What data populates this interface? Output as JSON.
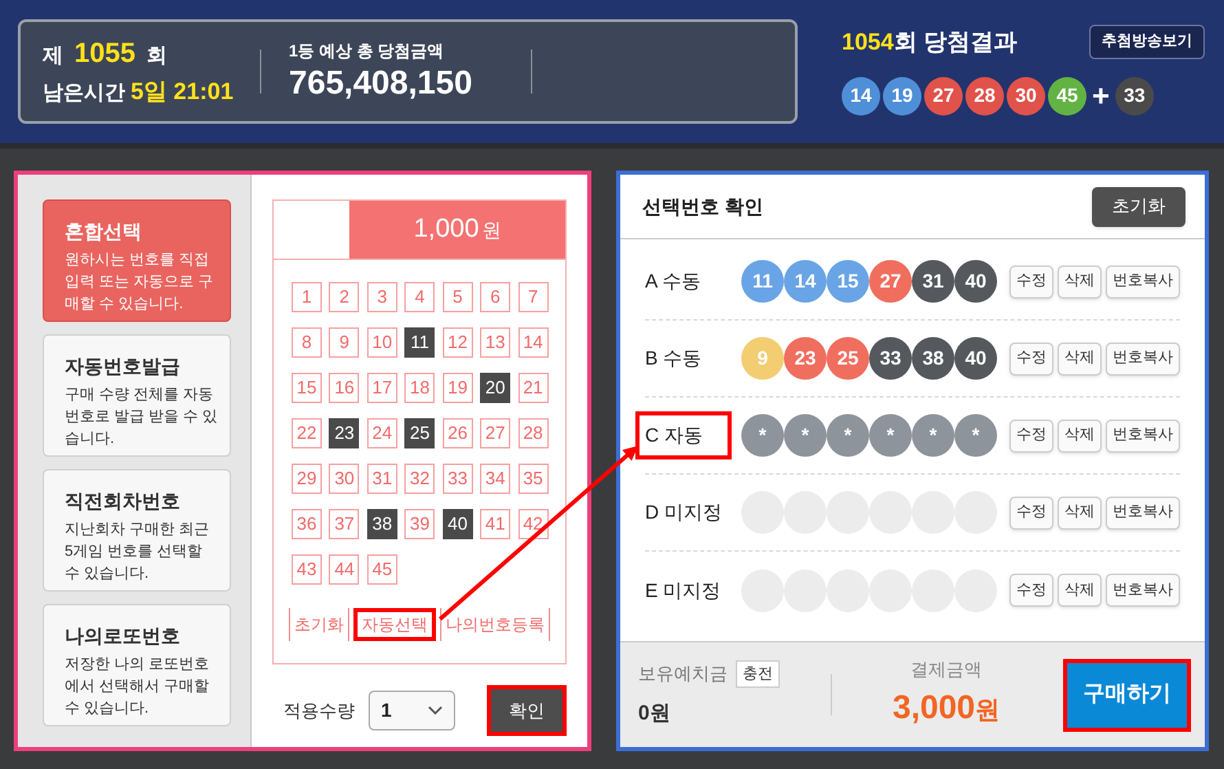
{
  "header": {
    "round_prefix": "제",
    "round_number": "1055",
    "round_suffix": "회",
    "remaining_label": "남은시간",
    "remaining_value": "5일 21:01",
    "jackpot_label": "1등 예상 총 당첨금액",
    "jackpot_amount": "765,408,150"
  },
  "last_result": {
    "round": "1054",
    "title": "회 당첨결과",
    "button": "추첨방송보기",
    "plus": "+",
    "balls": [
      {
        "number": "14",
        "color": "#4f8fd8"
      },
      {
        "number": "19",
        "color": "#4f8fd8"
      },
      {
        "number": "27",
        "color": "#e0524a"
      },
      {
        "number": "28",
        "color": "#e0524a"
      },
      {
        "number": "30",
        "color": "#e0524a"
      },
      {
        "number": "45",
        "color": "#62b344"
      }
    ],
    "bonus": {
      "number": "33",
      "color": "#4a4a4a"
    }
  },
  "modes": [
    {
      "title": "혼합선택",
      "description": "원하시는 번호를 직접 입력 또는 자동으로 구매할 수 있습니다.",
      "selected": true
    },
    {
      "title": "자동번호발급",
      "description": "구매 수량 전체를 자동번호로 발급 받을 수 있습니다.",
      "selected": false
    },
    {
      "title": "직전회차번호",
      "description": "지난회차 구매한 최근 5게임 번호를 선택할 수 있습니다.",
      "selected": false
    },
    {
      "title": "나의로또번호",
      "description": "저장한 나의 로또번호에서 선택해서 구매할 수 있습니다.",
      "selected": false
    }
  ],
  "ticket": {
    "price": "1,000",
    "price_unit": "원",
    "numbers": [
      {
        "number": "1",
        "selected": false
      },
      {
        "number": "2",
        "selected": false
      },
      {
        "number": "3",
        "selected": false
      },
      {
        "number": "4",
        "selected": false
      },
      {
        "number": "5",
        "selected": false
      },
      {
        "number": "6",
        "selected": false
      },
      {
        "number": "7",
        "selected": false
      },
      {
        "number": "8",
        "selected": false
      },
      {
        "number": "9",
        "selected": false
      },
      {
        "number": "10",
        "selected": false
      },
      {
        "number": "11",
        "selected": true
      },
      {
        "number": "12",
        "selected": false
      },
      {
        "number": "13",
        "selected": false
      },
      {
        "number": "14",
        "selected": false
      },
      {
        "number": "15",
        "selected": false
      },
      {
        "number": "16",
        "selected": false
      },
      {
        "number": "17",
        "selected": false
      },
      {
        "number": "18",
        "selected": false
      },
      {
        "number": "19",
        "selected": false
      },
      {
        "number": "20",
        "selected": true
      },
      {
        "number": "21",
        "selected": false
      },
      {
        "number": "22",
        "selected": false
      },
      {
        "number": "23",
        "selected": true
      },
      {
        "number": "24",
        "selected": false
      },
      {
        "number": "25",
        "selected": true
      },
      {
        "number": "26",
        "selected": false
      },
      {
        "number": "27",
        "selected": false
      },
      {
        "number": "28",
        "selected": false
      },
      {
        "number": "29",
        "selected": false
      },
      {
        "number": "30",
        "selected": false
      },
      {
        "number": "31",
        "selected": false
      },
      {
        "number": "32",
        "selected": false
      },
      {
        "number": "33",
        "selected": false
      },
      {
        "number": "34",
        "selected": false
      },
      {
        "number": "35",
        "selected": false
      },
      {
        "number": "36",
        "selected": false
      },
      {
        "number": "37",
        "selected": false
      },
      {
        "number": "38",
        "selected": true
      },
      {
        "number": "39",
        "selected": false
      },
      {
        "number": "40",
        "selected": true
      },
      {
        "number": "41",
        "selected": false
      },
      {
        "number": "42",
        "selected": false
      },
      {
        "number": "43",
        "selected": false
      },
      {
        "number": "44",
        "selected": false
      },
      {
        "number": "45",
        "selected": false
      }
    ],
    "buttons": [
      {
        "label": "초기화",
        "highlighted": false
      },
      {
        "label": "자동선택",
        "highlighted": true
      },
      {
        "label": "나의번호등록",
        "highlighted": false
      }
    ],
    "quantity_label": "적용수량",
    "quantity": "1",
    "confirm": {
      "label": "확인",
      "highlighted": true
    }
  },
  "selection": {
    "title": "선택번호 확인",
    "reset_button": "초기화",
    "rows": [
      {
        "label": "A 수동",
        "kind": "filled",
        "highlighted": false,
        "balls": [
          {
            "number": "11",
            "color": "#69a5e6"
          },
          {
            "number": "14",
            "color": "#69a5e6"
          },
          {
            "number": "15",
            "color": "#69a5e6"
          },
          {
            "number": "27",
            "color": "#f06e5e"
          },
          {
            "number": "31",
            "color": "#55595e"
          },
          {
            "number": "40",
            "color": "#55595e"
          }
        ],
        "actions": [
          "수정",
          "삭제",
          "번호복사"
        ]
      },
      {
        "label": "B 수동",
        "kind": "filled",
        "highlighted": false,
        "balls": [
          {
            "number": "9",
            "color": "#f2cd72"
          },
          {
            "number": "23",
            "color": "#f06e5e"
          },
          {
            "number": "25",
            "color": "#f06e5e"
          },
          {
            "number": "33",
            "color": "#55595e"
          },
          {
            "number": "38",
            "color": "#55595e"
          },
          {
            "number": "40",
            "color": "#55595e"
          }
        ],
        "actions": [
          "수정",
          "삭제",
          "번호복사"
        ]
      },
      {
        "label": "C 자동",
        "kind": "filled",
        "highlighted": true,
        "balls": [
          {
            "number": "*",
            "color": "#8e949c"
          },
          {
            "number": "*",
            "color": "#8e949c"
          },
          {
            "number": "*",
            "color": "#8e949c"
          },
          {
            "number": "*",
            "color": "#8e949c"
          },
          {
            "number": "*",
            "color": "#8e949c"
          },
          {
            "number": "*",
            "color": "#8e949c"
          }
        ],
        "actions": [
          "수정",
          "삭제",
          "번호복사"
        ]
      },
      {
        "label": "D 미지정",
        "kind": "empty",
        "highlighted": false,
        "actions": [
          "수정",
          "삭제",
          "번호복사"
        ]
      },
      {
        "label": "E 미지정",
        "kind": "empty",
        "highlighted": false,
        "actions": [
          "수정",
          "삭제",
          "번호복사"
        ]
      }
    ],
    "balance_label": "보유예치금",
    "charge_button": "충전",
    "balance": "0원",
    "payment_label": "결제금액",
    "payment_amount": "3,000",
    "payment_unit": "원",
    "buy": {
      "label": "구매하기",
      "highlighted": true
    }
  }
}
